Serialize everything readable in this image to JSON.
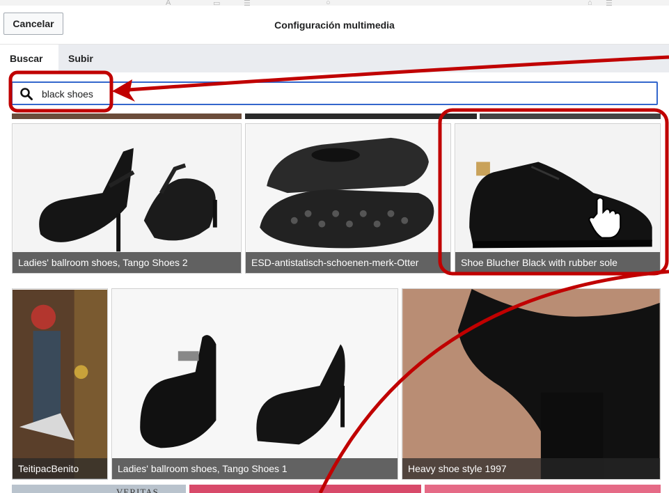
{
  "dialog": {
    "title": "Configuración multimedia",
    "cancel_label": "Cancelar",
    "tabs": [
      {
        "label": "Buscar",
        "active": true
      },
      {
        "label": "Subir",
        "active": false
      }
    ],
    "search": {
      "value": "black shoes",
      "icon": "search-icon"
    }
  },
  "results": [
    {
      "caption": "Ladies' ballroom shoes, Tango Shoes 2"
    },
    {
      "caption": "ESD-antistatisch-schoenen-merk-Otter"
    },
    {
      "caption": "Shoe Blucher Black with rubber sole"
    },
    {
      "caption": "TeitipacBenito"
    },
    {
      "caption": "Ladies' ballroom shoes, Tango Shoes 1"
    },
    {
      "caption": "Heavy shoe style 1997"
    }
  ],
  "partial_row": {
    "text": "VERITAS"
  },
  "annotations": {
    "color": "#c00000"
  },
  "accent": "#3366cc"
}
